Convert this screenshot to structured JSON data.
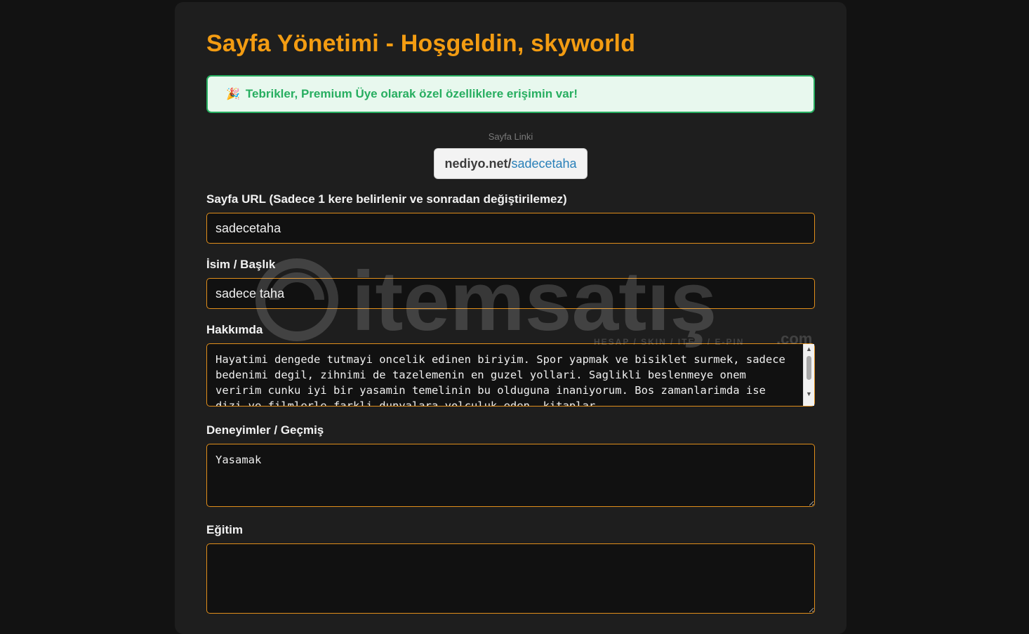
{
  "header": {
    "title": "Sayfa Yönetimi - Hoşgeldin, skyworld"
  },
  "premium": {
    "icon": "party-popper-icon",
    "emoji": "🎉",
    "message": "Tebrikler, Premium Üye olarak özel özelliklere erişimin var!"
  },
  "page_link": {
    "label": "Sayfa Linki",
    "domain": "nediyo.net/",
    "slug": "sadecetaha"
  },
  "form": {
    "url_label": "Sayfa URL (Sadece 1 kere belirlenir ve sonradan değiştirilemez)",
    "url_value": "sadecetaha",
    "name_label": "İsim / Başlık",
    "name_value": "sadece taha",
    "about_label": "Hakkımda",
    "about_value": "Hayatimi dengede tutmayi oncelik edinen biriyim. Spor yapmak ve bisiklet surmek, sadece bedenimi degil, zihnimi de tazelemenin en guzel yollari. Saglikli beslenmeye onem veririm cunku iyi bir yasamin temelinin bu olduguna inaniyorum. Bos zamanlarimda ise dizi ve filmlerle farkli dunyalara yolculuk eden, kitaplar",
    "experience_label": "Deneyimler / Geçmiş",
    "experience_value": "Yasamak",
    "education_label": "Eğitim",
    "education_value": ""
  },
  "watermark": {
    "brand": "itemsatış",
    "suffix": ".com",
    "tagline": "HESAP / SKIN / ITEM / E-PIN"
  },
  "colors": {
    "accent": "#f39c12",
    "success": "#27ae60",
    "link": "#2980b9",
    "panel": "#1e1e1e",
    "background": "#121212"
  }
}
